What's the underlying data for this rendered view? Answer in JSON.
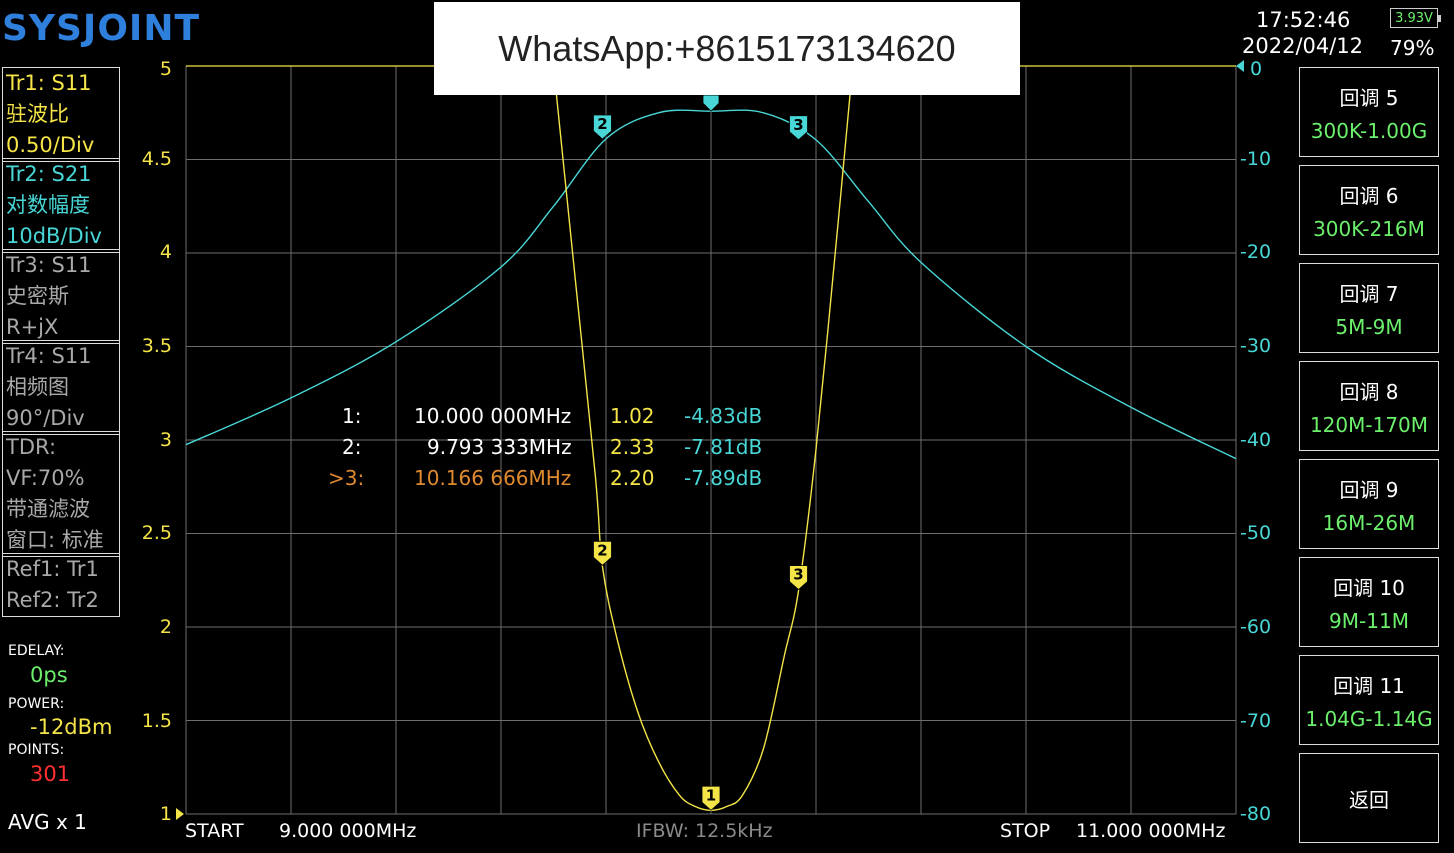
{
  "brand": "SYSJOINT",
  "watermark": "WhatsApp:+8615173134620",
  "status": {
    "time": "17:52:46",
    "date": "2022/04/12",
    "battery_voltage": "3.93V",
    "battery_percent": "79%"
  },
  "traces": [
    {
      "lines": [
        "Tr1:   S11",
        "驻波比",
        "0.50/Div"
      ],
      "color": "#f4e447"
    },
    {
      "lines": [
        "Tr2:   S21",
        "对数幅度",
        "10dB/Div"
      ],
      "color": "#48d6d6"
    },
    {
      "lines": [
        "Tr3:   S11",
        "史密斯",
        "R+jX"
      ],
      "color": "#a9a9a9"
    },
    {
      "lines": [
        "Tr4:   S11",
        "相频图",
        "90°/Div"
      ],
      "color": "#a9a9a9"
    },
    {
      "lines": [
        "TDR:",
        "VF:70%",
        "带通滤波",
        "窗口: 标准"
      ],
      "color": "#a9a9a9"
    },
    {
      "lines": [
        "Ref1:  Tr1",
        "Ref2:  Tr2"
      ],
      "color": "#a9a9a9"
    }
  ],
  "info": {
    "edelay_label": "EDELAY:",
    "edelay_value": "0ps",
    "power_label": "POWER:",
    "power_value": "-12dBm",
    "points_label": "POINTS:",
    "points_value": "301",
    "avg": "AVG x 1"
  },
  "axes": {
    "left_ticks": [
      "5",
      "4.5",
      "4",
      "3.5",
      "3",
      "2.5",
      "2",
      "1.5",
      "1"
    ],
    "right_ticks": [
      "0",
      "-10",
      "-20",
      "-30",
      "-40",
      "-50",
      "-60",
      "-70",
      "-80"
    ]
  },
  "sweep": {
    "start_label": "START",
    "start_value": "9.000 000MHz",
    "ifbw": "IFBW: 12.5kHz",
    "stop_label": "STOP",
    "stop_value": "11.000 000MHz"
  },
  "markers": [
    {
      "id": "1:",
      "freq": "10.000 000MHz",
      "swr": "1.02",
      "db": "-4.83dB",
      "active": false
    },
    {
      "id": "2:",
      "freq": "9.793 333MHz",
      "swr": "2.33",
      "db": "-7.81dB",
      "active": false
    },
    {
      "id": ">3:",
      "freq": "10.166 666MHz",
      "swr": "2.20",
      "db": "-7.89dB",
      "active": true
    }
  ],
  "marker_tags": {
    "m1": "1",
    "m2": "2",
    "m3": "3"
  },
  "menu": [
    {
      "title": "回调 5",
      "sub": "300K-1.00G"
    },
    {
      "title": "回调 6",
      "sub": "300K-216M"
    },
    {
      "title": "回调 7",
      "sub": "5M-9M"
    },
    {
      "title": "回调 8",
      "sub": "120M-170M"
    },
    {
      "title": "回调 9",
      "sub": "16M-26M"
    },
    {
      "title": "回调 10",
      "sub": "9M-11M"
    },
    {
      "title": "回调 11",
      "sub": "1.04G-1.14G"
    },
    {
      "title": "返回",
      "sub": ""
    }
  ],
  "colors": {
    "swr_trace": "#f4e447",
    "s21_trace": "#48d6d6",
    "grid": "#6e6e6e",
    "menu_sub": "#6cf06c"
  },
  "chart_data": {
    "type": "line",
    "x_unit": "MHz",
    "xlim": [
      9.0,
      11.0
    ],
    "y_left_lim": [
      1,
      5
    ],
    "y_right_lim": [
      -80,
      0
    ],
    "series": [
      {
        "axis": "left",
        "color": "#f4e447",
        "x": [
          9.7,
          9.74,
          9.78,
          9.793,
          9.82,
          9.86,
          9.9,
          9.94,
          9.97,
          10.0,
          10.03,
          10.06,
          10.1,
          10.14,
          10.167,
          10.2,
          10.24,
          10.27
        ],
        "y": [
          5.0,
          3.9,
          2.8,
          2.33,
          1.95,
          1.55,
          1.28,
          1.1,
          1.04,
          1.02,
          1.04,
          1.1,
          1.35,
          1.85,
          2.2,
          2.95,
          4.1,
          5.0
        ]
      },
      {
        "axis": "right",
        "color": "#48d6d6",
        "x": [
          9.0,
          9.2,
          9.4,
          9.6,
          9.7,
          9.8,
          9.9,
          10.0,
          10.1,
          10.2,
          10.3,
          10.4,
          10.6,
          10.8,
          11.0
        ],
        "y": [
          -40.5,
          -35.5,
          -29.5,
          -21.5,
          -15.0,
          -7.8,
          -5.0,
          -4.83,
          -5.0,
          -7.9,
          -14.5,
          -21.0,
          -30.0,
          -36.5,
          -42.0
        ]
      }
    ]
  }
}
